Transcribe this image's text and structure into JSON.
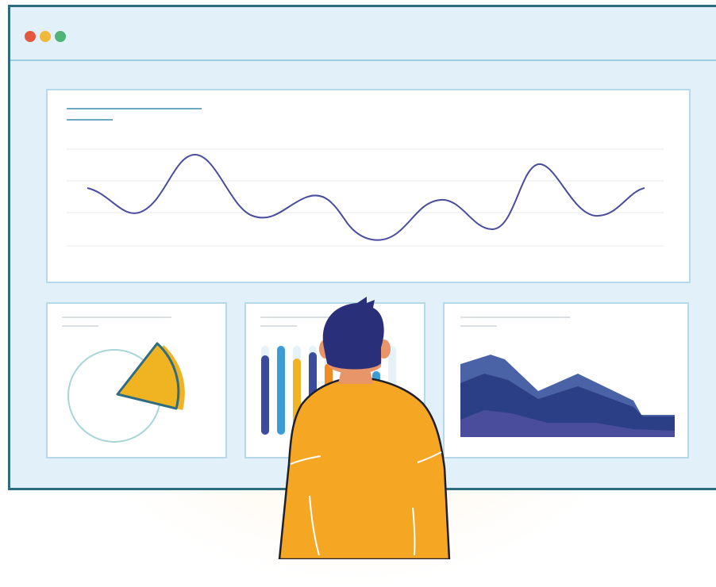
{
  "window": {
    "traffic_lights": [
      {
        "name": "close",
        "color": "#e4583e"
      },
      {
        "name": "minimize",
        "color": "#f0b93a"
      },
      {
        "name": "maximize",
        "color": "#4fb37a"
      }
    ]
  },
  "panels": {
    "line_chart": {
      "type": "line",
      "stroke": "#4a4c9c"
    },
    "pie_chart": {
      "type": "pie",
      "slice_color": "#f0b322",
      "outline": "#2f6d80"
    },
    "bar_chart": {
      "type": "bar",
      "bar_colors": [
        "#3c4c9c",
        "#3d9bd6",
        "#f0b322",
        "#3c4c9c",
        "#f08a22",
        "#4fb37a",
        "#3c4c9c",
        "#3d9bd6",
        "#e4583e"
      ]
    },
    "area_chart": {
      "type": "area",
      "colors": [
        "#4a63a6",
        "#2b3f86",
        "#4a4c9c"
      ]
    }
  },
  "figure": {
    "shirt_color": "#f5a623",
    "hair_color": "#2a2f7a",
    "skin_color": "#e8956a"
  }
}
